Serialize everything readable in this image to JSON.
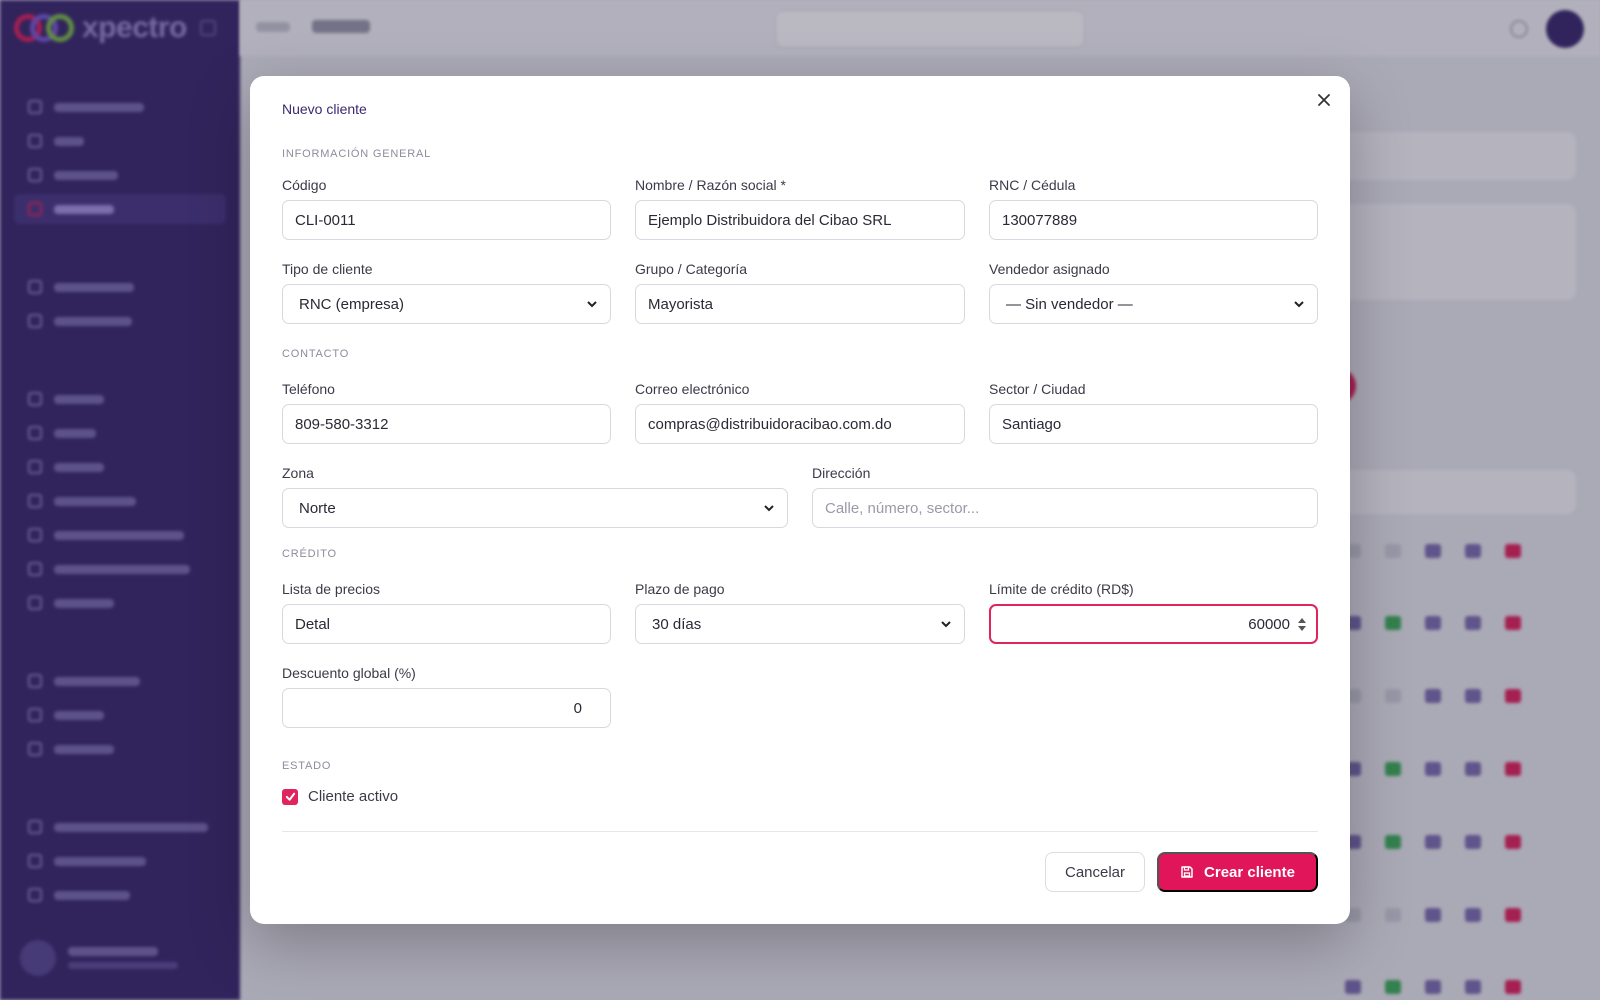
{
  "modal": {
    "title": "Nuevo cliente",
    "sections": {
      "general": "INFORMACIÓN GENERAL",
      "contact": "CONTACTO",
      "credit": "CRÉDITO",
      "status": "ESTADO"
    },
    "fields": {
      "codigo": {
        "label": "Código",
        "value": "CLI-0011"
      },
      "nombre": {
        "label": "Nombre / Razón social *",
        "value": "Ejemplo Distribuidora del Cibao SRL"
      },
      "rnc": {
        "label": "RNC / Cédula",
        "value": "130077889"
      },
      "tipo": {
        "label": "Tipo de cliente",
        "value": "RNC (empresa)"
      },
      "grupo": {
        "label": "Grupo / Categoría",
        "value": "Mayorista"
      },
      "vendedor": {
        "label": "Vendedor asignado",
        "value": "— Sin vendedor —"
      },
      "telefono": {
        "label": "Teléfono",
        "value": "809-580-3312"
      },
      "correo": {
        "label": "Correo electrónico",
        "value": "compras@distribuidoracibao.com.do"
      },
      "sector": {
        "label": "Sector / Ciudad",
        "value": "Santiago"
      },
      "zona": {
        "label": "Zona",
        "value": "Norte"
      },
      "direccion": {
        "label": "Dirección",
        "value": "",
        "placeholder": "Calle, número, sector..."
      },
      "lista": {
        "label": "Lista de precios",
        "value": "Detal"
      },
      "plazo": {
        "label": "Plazo de pago",
        "value": "30 días"
      },
      "limite": {
        "label": "Límite de crédito (RD$)",
        "value": "60000"
      },
      "descuento": {
        "label": "Descuento global (%)",
        "value": "0"
      }
    },
    "active_checkbox": {
      "label": "Cliente activo",
      "checked": true
    },
    "buttons": {
      "cancel": "Cancelar",
      "create": "Crear cliente"
    }
  },
  "colors": {
    "accent": "#e0155a",
    "sidebar": "#3b2a6e",
    "title": "#3b2a6e"
  },
  "icons": [
    "close-icon",
    "chevron-down-icon",
    "save-icon",
    "check-icon",
    "spinner-arrows-icon"
  ]
}
